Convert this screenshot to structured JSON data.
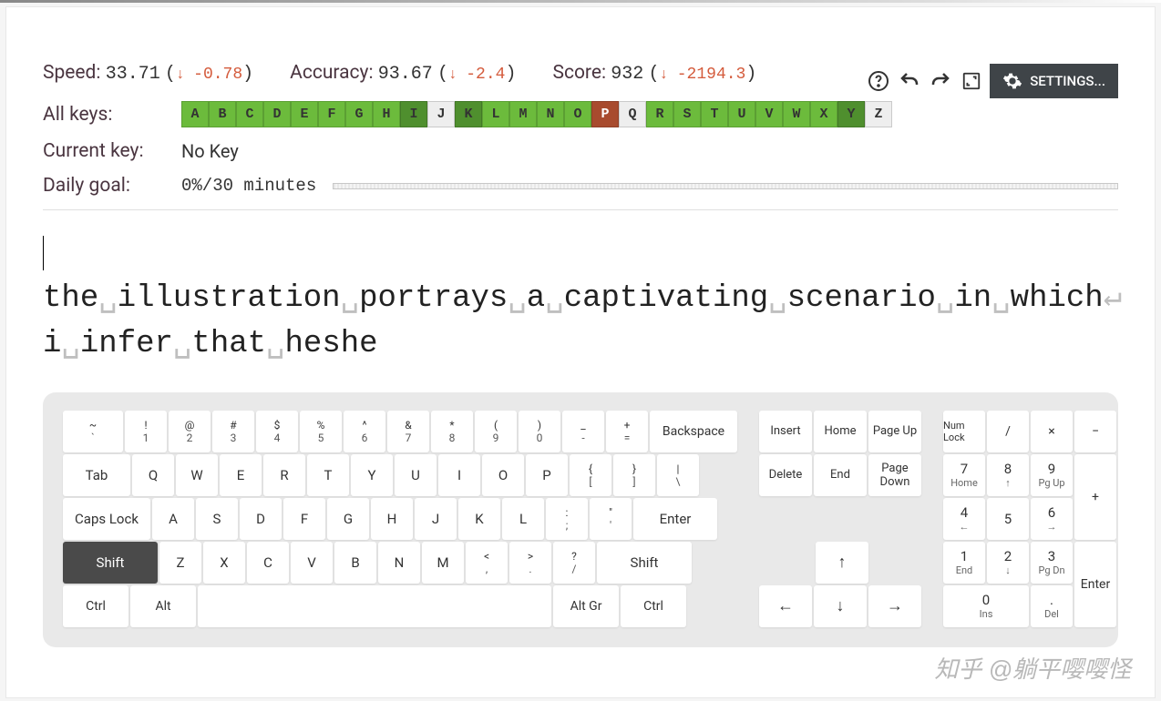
{
  "toolbar": {
    "settings_label": "SETTINGS..."
  },
  "stats": {
    "speed": {
      "label": "Speed:",
      "value": "33.71",
      "delta": "-0.78",
      "dir": "down"
    },
    "accuracy": {
      "label": "Accuracy:",
      "value": "93.67",
      "delta": "-2.4",
      "dir": "down"
    },
    "score": {
      "label": "Score:",
      "value": "932",
      "delta": "-2194.3",
      "dir": "down"
    }
  },
  "all_keys_label": "All keys:",
  "current_key_label": "Current key:",
  "current_key_value": "No Key",
  "daily_goal_label": "Daily goal:",
  "daily_goal_value": "0%/30 minutes",
  "key_cells": [
    {
      "l": "A",
      "c": "k-green"
    },
    {
      "l": "B",
      "c": "k-green"
    },
    {
      "l": "C",
      "c": "k-green"
    },
    {
      "l": "D",
      "c": "k-green"
    },
    {
      "l": "E",
      "c": "k-green"
    },
    {
      "l": "F",
      "c": "k-green"
    },
    {
      "l": "G",
      "c": "k-green"
    },
    {
      "l": "H",
      "c": "k-green"
    },
    {
      "l": "I",
      "c": "k-dgreen"
    },
    {
      "l": "J",
      "c": "k-grey"
    },
    {
      "l": "K",
      "c": "k-dgreen"
    },
    {
      "l": "L",
      "c": "k-green"
    },
    {
      "l": "M",
      "c": "k-green"
    },
    {
      "l": "N",
      "c": "k-green"
    },
    {
      "l": "O",
      "c": "k-green"
    },
    {
      "l": "P",
      "c": "k-brown"
    },
    {
      "l": "Q",
      "c": "k-grey"
    },
    {
      "l": "R",
      "c": "k-green"
    },
    {
      "l": "S",
      "c": "k-green"
    },
    {
      "l": "T",
      "c": "k-green"
    },
    {
      "l": "U",
      "c": "k-green"
    },
    {
      "l": "V",
      "c": "k-green"
    },
    {
      "l": "W",
      "c": "k-green"
    },
    {
      "l": "X",
      "c": "k-green"
    },
    {
      "l": "Y",
      "c": "k-dgreen"
    },
    {
      "l": "Z",
      "c": "k-grey"
    }
  ],
  "typing": {
    "line1": "the␣illustration␣portrays␣a␣captivating␣scenario␣in␣which",
    "line2": "i␣infer␣that␣heshe"
  },
  "keyboard": {
    "row1": [
      {
        "t": "~",
        "b": "`"
      },
      {
        "t": "!",
        "b": "1"
      },
      {
        "t": "@",
        "b": "2"
      },
      {
        "t": "#",
        "b": "3"
      },
      {
        "t": "$",
        "b": "4"
      },
      {
        "t": "%",
        "b": "5"
      },
      {
        "t": "^",
        "b": "6"
      },
      {
        "t": "&",
        "b": "7"
      },
      {
        "t": "*",
        "b": "8"
      },
      {
        "t": "(",
        "b": "9"
      },
      {
        "t": ")",
        "b": "0"
      },
      {
        "t": "_",
        "b": "-"
      },
      {
        "t": "+",
        "b": "="
      }
    ],
    "backspace": "Backspace",
    "tab": "Tab",
    "row2": [
      "Q",
      "W",
      "E",
      "R",
      "T",
      "Y",
      "U",
      "I",
      "O",
      "P"
    ],
    "row2b": [
      {
        "t": "{",
        "b": "["
      },
      {
        "t": "}",
        "b": "]"
      },
      {
        "t": "|",
        "b": "\\"
      }
    ],
    "caps": "Caps Lock",
    "row3": [
      "A",
      "S",
      "D",
      "F",
      "G",
      "H",
      "J",
      "K",
      "L"
    ],
    "row3b": [
      {
        "t": ":",
        "b": ";"
      },
      {
        "t": "\"",
        "b": "'"
      }
    ],
    "enter": "Enter",
    "shift": "Shift",
    "row4": [
      "Z",
      "X",
      "C",
      "V",
      "B",
      "N",
      "M"
    ],
    "row4b": [
      {
        "t": "<",
        "b": ","
      },
      {
        "t": ">",
        "b": "."
      },
      {
        "t": "?",
        "b": "/"
      }
    ],
    "ctrl": "Ctrl",
    "alt": "Alt",
    "altgr": "Alt Gr",
    "nav": {
      "insert": "Insert",
      "home": "Home",
      "pageup": "Page Up",
      "delete": "Delete",
      "end": "End",
      "pagedown": "Page Down"
    },
    "arrows": {
      "up": "↑",
      "left": "←",
      "down": "↓",
      "right": "→"
    },
    "numpad": {
      "numlock": "Num Lock",
      "div": "/",
      "mul": "×",
      "sub": "−",
      "7": {
        "t": "7",
        "b": "Home"
      },
      "8": {
        "t": "8",
        "b": "↑"
      },
      "9": {
        "t": "9",
        "b": "Pg Up"
      },
      "add": "+",
      "4": {
        "t": "4",
        "b": "←"
      },
      "5": {
        "t": "5",
        "b": ""
      },
      "6": {
        "t": "6",
        "b": "→"
      },
      "1": {
        "t": "1",
        "b": "End"
      },
      "2": {
        "t": "2",
        "b": "↓"
      },
      "3": {
        "t": "3",
        "b": "Pg Dn"
      },
      "enter": "Enter",
      "0": {
        "t": "0",
        "b": "Ins"
      },
      "dot": {
        "t": ".",
        "b": "Del"
      }
    }
  },
  "watermark": "知乎 @躺平嘤嘤怪"
}
